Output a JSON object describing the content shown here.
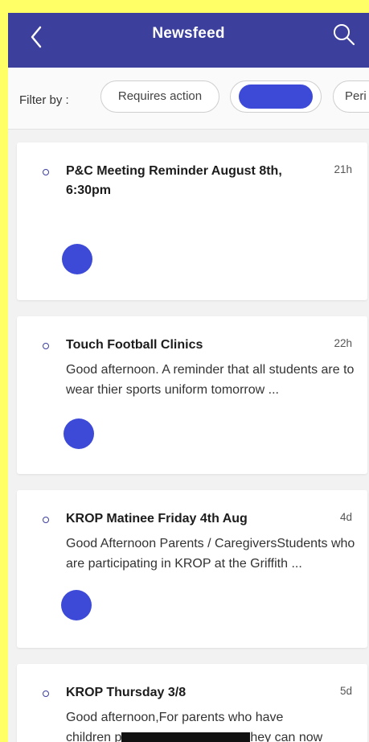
{
  "header": {
    "title": "Newsfeed",
    "back_icon": "chevron-left-icon",
    "search_icon": "search-icon"
  },
  "filters": {
    "label": "Filter by :",
    "chips": [
      "Requires action",
      "",
      "Peri"
    ]
  },
  "posts": [
    {
      "title": "P&C Meeting Reminder August 8th, 6:30pm",
      "time": "21h",
      "preview": ""
    },
    {
      "title": "Touch Football Clinics",
      "time": "22h",
      "preview": "Good afternoon. A reminder that all students are to wear thier sports uniform tomorrow ..."
    },
    {
      "title": "KROP Matinee Friday 4th Aug",
      "time": "4d",
      "preview": "Good Afternoon Parents / CaregiversStudents who are participating in KROP at the Griffith ..."
    },
    {
      "title": "KROP Thursday 3/8",
      "time": "5d",
      "preview": "Good afternoon,For parents who have",
      "preview_line2_start": "children p",
      "preview_line2_end": "hey can now"
    }
  ],
  "colors": {
    "header_bg": "#3c3f9c",
    "accent": "#3d4ad8",
    "frame": "#ffff66"
  }
}
